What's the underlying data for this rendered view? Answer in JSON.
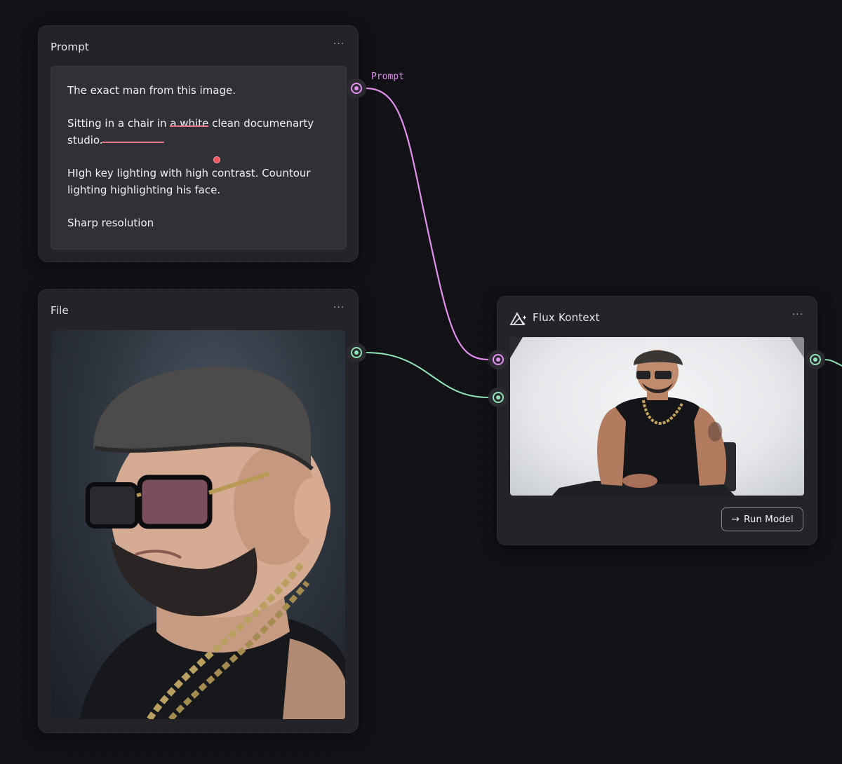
{
  "nodes": {
    "prompt": {
      "title": "Prompt",
      "menu_label": "···",
      "text": {
        "line1": "The exact man from this image.",
        "line2_part1": "Sitting in a chair in ",
        "line2_struck": "a white",
        "line2_part2": " clean documenarty studio.",
        "line3": "HIgh key lighting with high contrast. Countour lighting highlighting his face.",
        "line4": "Sharp resolution"
      },
      "output_label": "Prompt"
    },
    "file": {
      "title": "File",
      "menu_label": "···"
    },
    "flux": {
      "title": "Flux Kontext",
      "menu_label": "···",
      "logo_icon": "triangle-logo-icon",
      "run_label": "Run Model",
      "run_icon": "arrow-right-icon"
    }
  },
  "colors": {
    "prompt_wire": "#e38fef",
    "image_wire": "#8fe3b5",
    "annotation": "#e77a86",
    "canvas_bg": "#121116",
    "node_bg": "#242328"
  }
}
